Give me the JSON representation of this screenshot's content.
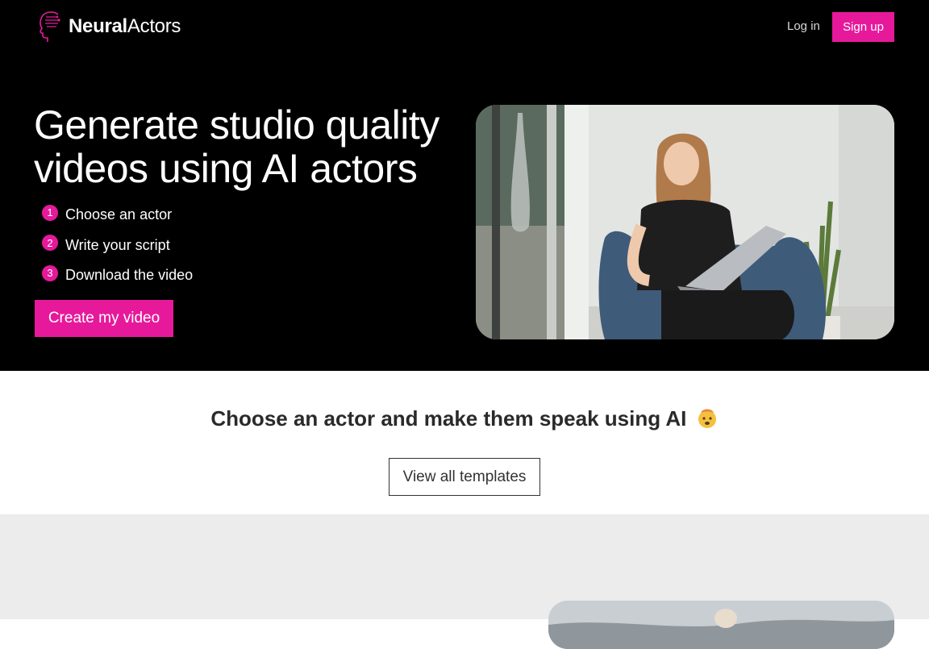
{
  "brand": {
    "name_bold": "Neural",
    "name_regular": "Actors",
    "accent_color": "#e6199b"
  },
  "nav": {
    "login_label": "Log in",
    "signup_label": "Sign up"
  },
  "hero": {
    "headline": "Generate studio quality videos using AI actors",
    "steps": [
      {
        "number": "1",
        "label": "Choose an actor"
      },
      {
        "number": "2",
        "label": "Write your script"
      },
      {
        "number": "3",
        "label": "Download the video"
      }
    ],
    "cta_label": "Create my video"
  },
  "mid": {
    "title": "Choose an actor and make them speak using AI",
    "emoji_icon": "exploding-head-icon",
    "templates_label": "View all templates"
  }
}
